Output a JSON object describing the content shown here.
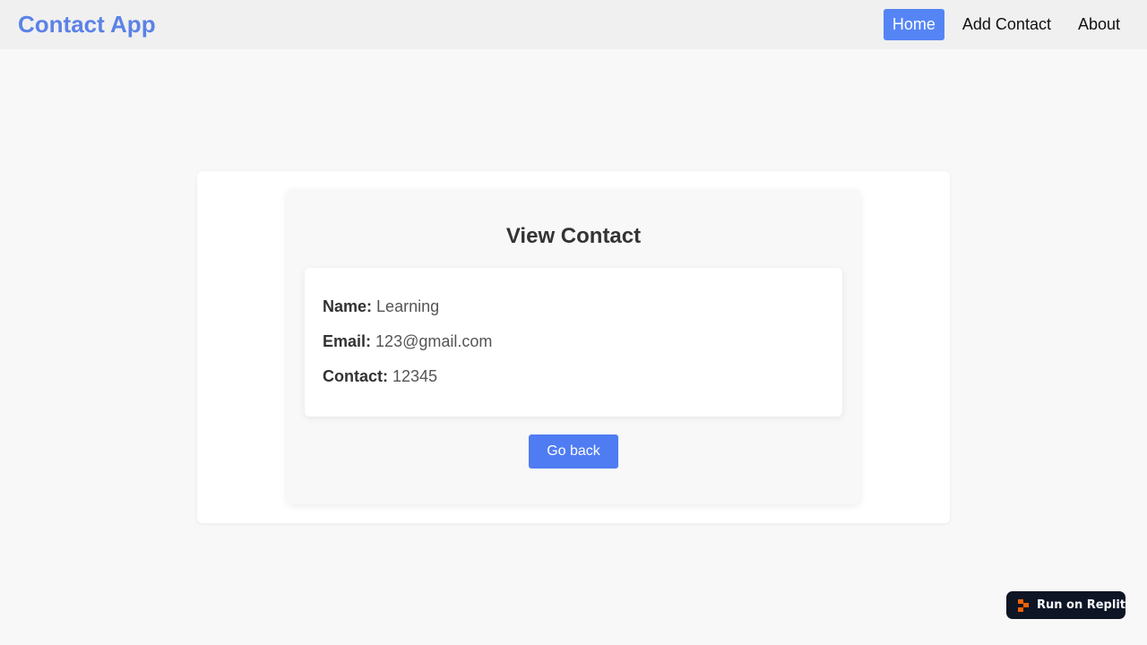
{
  "nav": {
    "brand": "Contact App",
    "links": [
      {
        "label": "Home",
        "active": true
      },
      {
        "label": "Add Contact",
        "active": false
      },
      {
        "label": "About",
        "active": false
      }
    ]
  },
  "card": {
    "title": "View Contact",
    "fields": [
      {
        "label": "Name:",
        "value": "Learning"
      },
      {
        "label": "Email:",
        "value": "123@gmail.com"
      },
      {
        "label": "Contact:",
        "value": "12345"
      }
    ],
    "back_button": "Go back"
  },
  "badge": {
    "label": "Run on Replit",
    "icon": "replit-logo-icon"
  },
  "colors": {
    "brand": "#5b82e6",
    "accent": "#5585f5",
    "button": "#4f7cf2",
    "badge_bg": "#0e1525",
    "badge_icon": "#f26207"
  }
}
